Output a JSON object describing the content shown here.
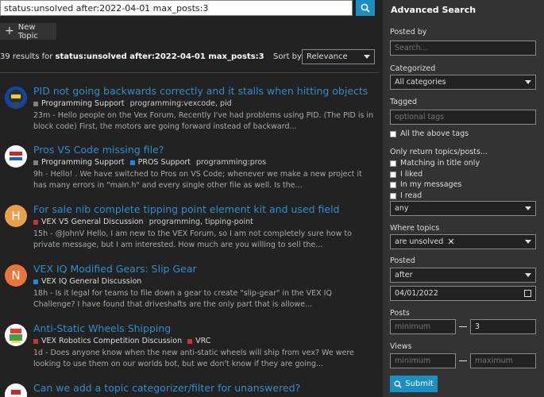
{
  "search": {
    "query": "status:unsolved after:2022-04-01 max_posts:3"
  },
  "new_topic_label": "New Topic",
  "results_summary": {
    "count_text": "39 results for",
    "query_text": "status:unsolved after:2022-04-01 max_posts:3"
  },
  "sort": {
    "label": "Sort by",
    "value": "Relevance"
  },
  "results": [
    {
      "title": "PID not going backwards correctly and it stalls when hitting objects",
      "category": "Programming Support",
      "category_color": "#808080",
      "tags": "programming:vexcode, pid",
      "time": "23m",
      "blurb": "Hello people on the Vex Forum, Recently I've had problems using PID. (The PID is in block code) First, the motors are going forward instead of backward..."
    },
    {
      "title": "Pros VS Code missing file?",
      "category": "Programming Support",
      "category_color": "#808080",
      "category2": "PROS Support",
      "category2_color": "#1e88e5",
      "tags": "programming:pros",
      "time": "9h",
      "blurb": "Hello! . We have switched to Pros on VS Code; whenever we make a new project it has many errors in \"main.h\" and every single other file as well. Is the..."
    },
    {
      "title": "For sale nib complete tipping point element kit and used field",
      "category": "VEX V5 General Discussion",
      "category_color": "#d32f2f",
      "tags": "programming, tipping-point",
      "avatar_letter": "H",
      "avatar_color": "#e8a04c",
      "time": "15h",
      "blurb": "@JohnV Hello, I am new to the VEX Forum, so I am not completely sure how to private message, but I am interested. How much are you willing to sell the..."
    },
    {
      "title": "VEX IQ Modified Gears: Slip Gear",
      "category": "VEX IQ General Discussion",
      "category_color": "#1e88e5",
      "avatar_letter": "N",
      "avatar_color": "#e8763c",
      "time": "18h",
      "blurb": "Is it legal for teams to file down a gear to create \"slip-gear\" in the VEX IQ Challenge? I have found that driveshafts are the only part that is allowe..."
    },
    {
      "title": "Anti-Static Wheels Shipping",
      "category": "VEX Robotics Competition Discussion",
      "category_color": "#d32f2f",
      "category2": "VRC",
      "category2_color": "#d32f2f",
      "time": "1d",
      "blurb": "Does anyone know when the new anti-static wheels will ship from vex? We were looking to use them on our worlds bot, but we don't know if they are going..."
    },
    {
      "title": "Can we add a topic categorizer/filter for unanswered?"
    }
  ],
  "sidebar": {
    "title": "Advanced Search",
    "posted_by_label": "Posted by",
    "posted_by_placeholder": "Search...",
    "categorized_label": "Categorized",
    "categorized_value": "All categories",
    "tagged_label": "Tagged",
    "tagged_placeholder": "optional tags",
    "all_tags_label": "All the above tags",
    "only_return_label": "Only return topics/posts...",
    "only_return_options": [
      "Matching in title only",
      "I liked",
      "In my messages",
      "I read"
    ],
    "only_return_select": "any",
    "where_topics_label": "Where topics",
    "where_topics_value": "are unsolved",
    "posted_label": "Posted",
    "posted_value": "after",
    "posted_date": "04/01/2022",
    "posts_label": "Posts",
    "posts_min_placeholder": "minimum",
    "posts_max_value": "3",
    "views_label": "Views",
    "views_min_placeholder": "minimum",
    "views_max_placeholder": "maximum",
    "submit_label": "Submit"
  },
  "colors": {
    "accent": "#1a8fc2",
    "link": "#2d8fc9"
  }
}
